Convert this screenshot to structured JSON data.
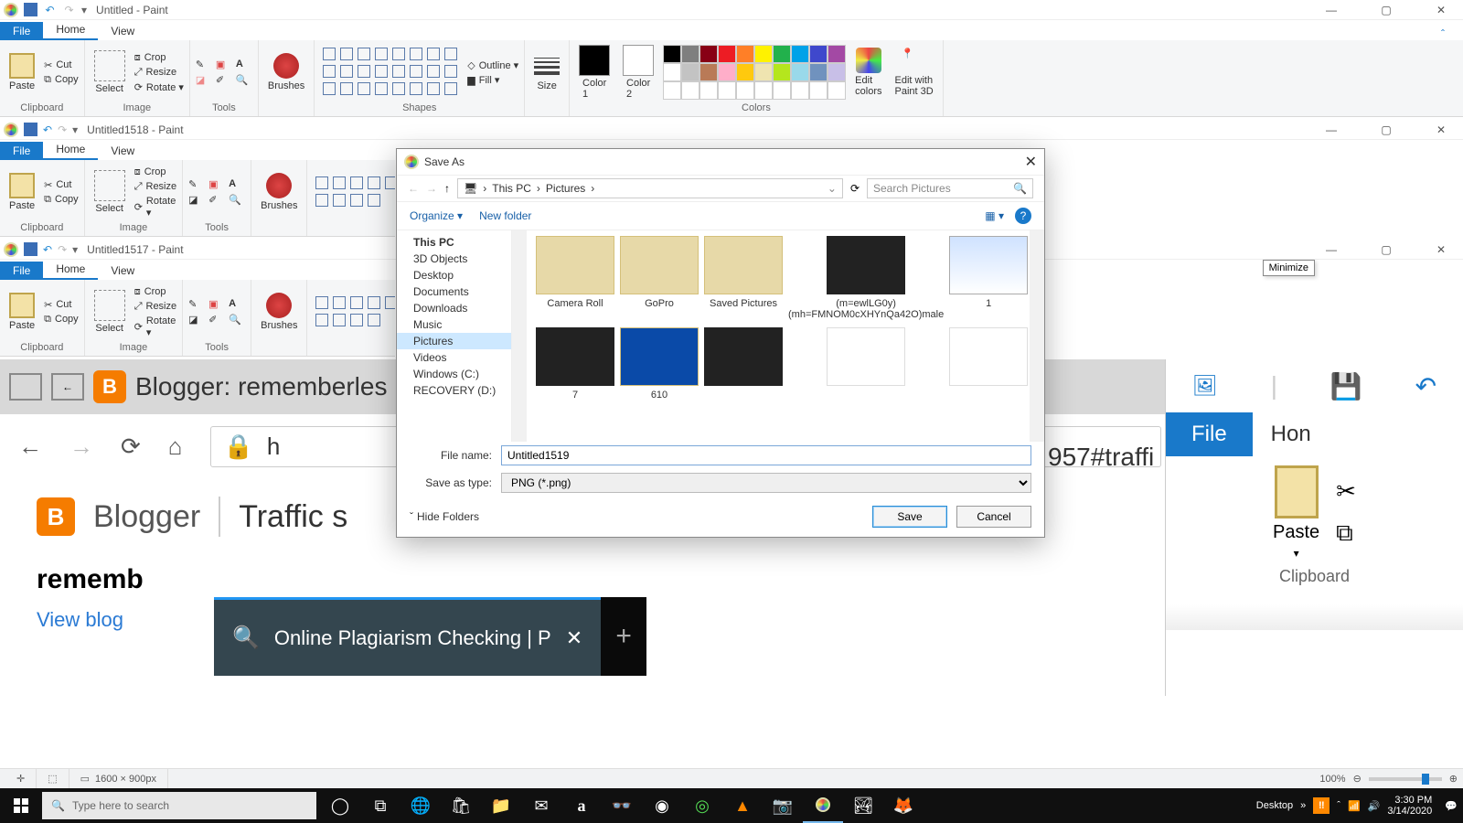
{
  "paint1": {
    "title": "Untitled - Paint"
  },
  "paint2": {
    "title": "Untitled1518 - Paint"
  },
  "paint3": {
    "title": "Untitled1517 - Paint"
  },
  "ribbon_tabs": {
    "file": "File",
    "home": "Home",
    "view": "View"
  },
  "groups": {
    "paste": "Paste",
    "cut": "Cut",
    "copy": "Copy",
    "clipboard": "Clipboard",
    "select": "Select",
    "crop": "Crop",
    "resize": "Resize",
    "rotate": "Rotate ▾",
    "image": "Image",
    "tools": "Tools",
    "brushes": "Brushes",
    "shapes": "Shapes",
    "outline": "Outline ▾",
    "fill": "Fill ▾",
    "size": "Size",
    "color1": "Color\n1",
    "color2": "Color\n2",
    "edit_colors": "Edit\ncolors",
    "paint3d": "Edit with\nPaint 3D",
    "colors": "Colors"
  },
  "palette_colors": [
    "#000",
    "#7f7f7f",
    "#880015",
    "#ed1c24",
    "#ff7f27",
    "#fff200",
    "#22b14c",
    "#00a2e8",
    "#3f48cc",
    "#a349a4",
    "#fff",
    "#c3c3c3",
    "#b97a57",
    "#ffaec9",
    "#ffc90e",
    "#efe4b0",
    "#b5e61d",
    "#99d9ea",
    "#7092be",
    "#c8bfe7"
  ],
  "dialog": {
    "title": "Save As",
    "crumbs": {
      "this_pc": "This PC",
      "pictures": "Pictures"
    },
    "search_placeholder": "Search Pictures",
    "organize": "Organize ▾",
    "new_folder": "New folder",
    "tree": [
      {
        "label": "This PC",
        "bold": true
      },
      {
        "label": "3D Objects"
      },
      {
        "label": "Desktop"
      },
      {
        "label": "Documents"
      },
      {
        "label": "Downloads"
      },
      {
        "label": "Music"
      },
      {
        "label": "Pictures",
        "sel": true
      },
      {
        "label": "Videos"
      },
      {
        "label": "Windows (C:)"
      },
      {
        "label": "RECOVERY (D:)"
      }
    ],
    "files_row1": [
      {
        "name": "Camera Roll",
        "type": "folder"
      },
      {
        "name": "GoPro",
        "type": "folder"
      },
      {
        "name": "Saved Pictures",
        "type": "folder"
      },
      {
        "name": "(m=ewlLG0y)(mh=FMNOM0cXHYnQa42O)male",
        "type": "dark"
      },
      {
        "name": "1",
        "type": "img"
      }
    ],
    "files_row2": [
      {
        "name": "7",
        "type": "dark"
      },
      {
        "name": "610",
        "type": "desk"
      },
      {
        "name": "",
        "type": "dark"
      },
      {
        "name": "",
        "type": "blank"
      },
      {
        "name": "",
        "type": "blank"
      }
    ],
    "file_name_label": "File name:",
    "file_name": "Untitled1519",
    "save_type_label": "Save as type:",
    "save_type": "PNG (*.png)",
    "hide": "Hide Folders",
    "save": "Save",
    "cancel": "Cancel"
  },
  "browser": {
    "page_title": "Blogger: rememberles",
    "url_fragment": "h",
    "url_suffix": "957#traffi",
    "heading": "Traffic s",
    "brand": "Blogger",
    "blog_name": "rememb",
    "view_blog": "View blog",
    "tab": "Online Plagiarism Checking | P"
  },
  "rightpaint": {
    "file": "File",
    "home": "Hon",
    "paste": "Paste",
    "clipboard": "Clipboard"
  },
  "tooltip": "Minimize",
  "statusbar": {
    "dims": "1600 × 900px",
    "zoom": "100%"
  },
  "taskbar": {
    "search": "Type here to search",
    "desktop": "Desktop",
    "time": "3:30 PM",
    "date": "3/14/2020"
  }
}
